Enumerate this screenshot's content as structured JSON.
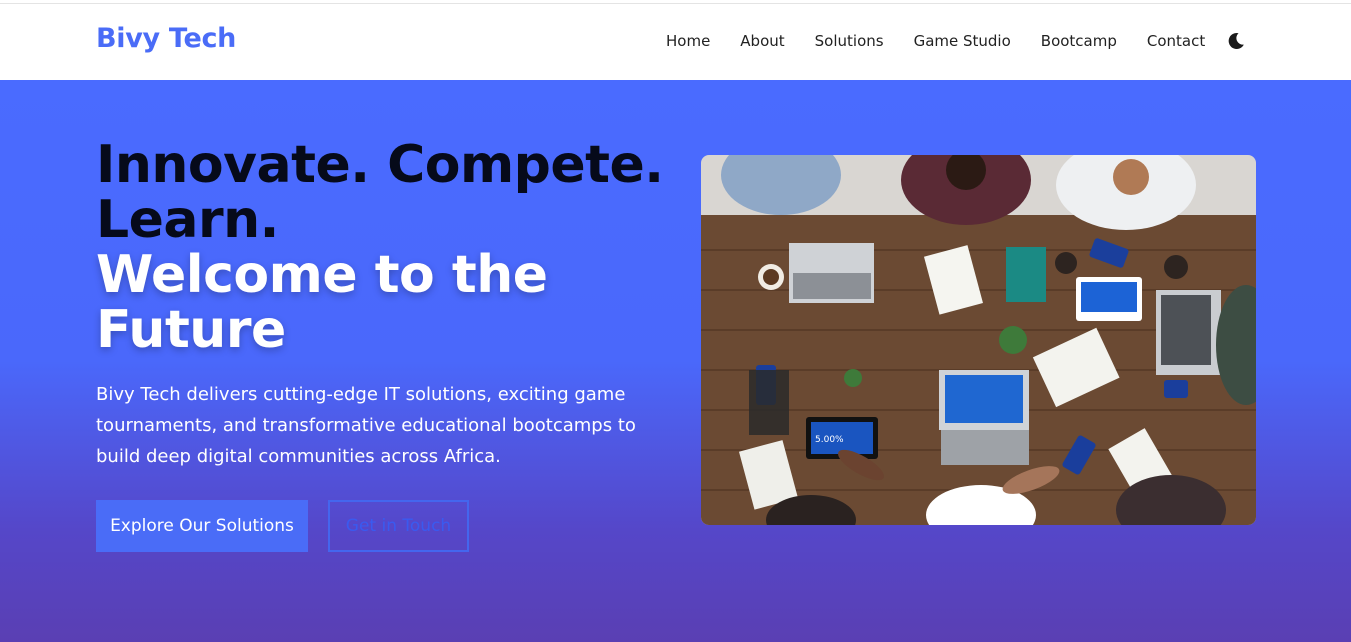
{
  "nav": {
    "brand": "Bivy Tech",
    "links": [
      "Home",
      "About",
      "Solutions",
      "Game Studio",
      "Bootcamp",
      "Contact"
    ],
    "theme_icon": "moon-icon"
  },
  "hero": {
    "headline_line1": "Innovate. Compete.",
    "headline_line2": "Learn.",
    "headline_line3": "Welcome to the",
    "headline_line4": "Future",
    "description": "Bivy Tech delivers cutting-edge IT solutions, exciting game tournaments, and transformative educational bootcamps to build deep digital communities across Africa.",
    "primary_button": "Explore Our Solutions",
    "secondary_button": "Get in Touch",
    "image_screen_text": "5.00%"
  },
  "colors": {
    "brand": "#4a6cf7",
    "hero_top": "#4a6bff",
    "hero_bottom": "#5a3fb3",
    "headline_dark": "#060a1a"
  }
}
